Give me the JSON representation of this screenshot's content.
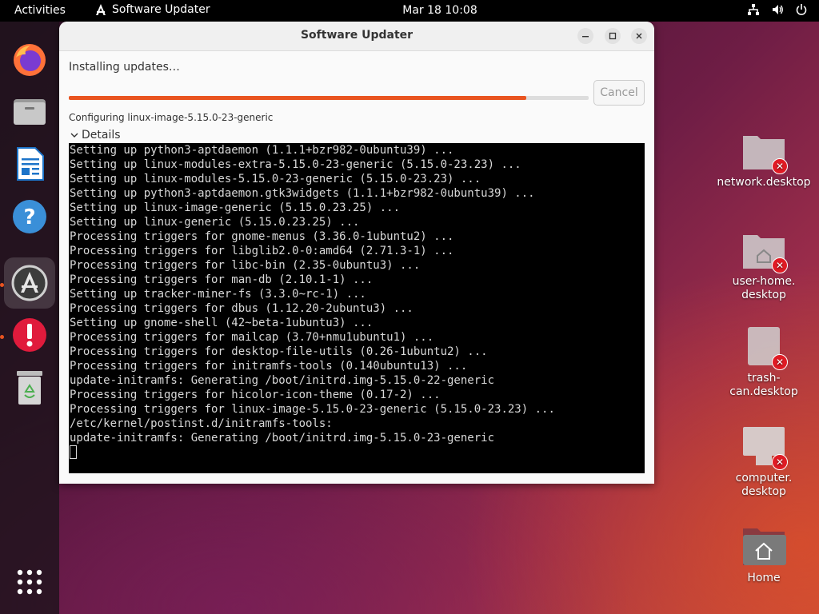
{
  "topbar": {
    "activities": "Activities",
    "app_name": "Software Updater",
    "clock": "Mar 18  10:08"
  },
  "dock": {
    "items": [
      "firefox-icon",
      "files-icon",
      "writer-icon",
      "help-icon",
      "software-updater-icon",
      "error-reporter-icon",
      "trash-icon",
      "app-grid-icon"
    ]
  },
  "window": {
    "title": "Software Updater",
    "status": "Installing updates…",
    "progress": 0.88,
    "cancel_label": "Cancel",
    "config_line": "Configuring linux-image-5.15.0-23-generic",
    "details_label": "Details",
    "terminal_lines": [
      "Setting up python3-aptdaemon (1.1.1+bzr982-0ubuntu39) ...",
      "Setting up linux-modules-extra-5.15.0-23-generic (5.15.0-23.23) ...",
      "Setting up linux-modules-5.15.0-23-generic (5.15.0-23.23) ...",
      "Setting up python3-aptdaemon.gtk3widgets (1.1.1+bzr982-0ubuntu39) ...",
      "Setting up linux-image-generic (5.15.0.23.25) ...",
      "Setting up linux-generic (5.15.0.23.25) ...",
      "Processing triggers for gnome-menus (3.36.0-1ubuntu2) ...",
      "Processing triggers for libglib2.0-0:amd64 (2.71.3-1) ...",
      "Processing triggers for libc-bin (2.35-0ubuntu3) ...",
      "Processing triggers for man-db (2.10.1-1) ...",
      "Setting up tracker-miner-fs (3.3.0~rc-1) ...",
      "Processing triggers for dbus (1.12.20-2ubuntu3) ...",
      "Setting up gnome-shell (42~beta-1ubuntu3) ...",
      "Processing triggers for mailcap (3.70+nmu1ubuntu1) ...",
      "Processing triggers for desktop-file-utils (0.26-1ubuntu2) ...",
      "Processing triggers for initramfs-tools (0.140ubuntu13) ...",
      "update-initramfs: Generating /boot/initrd.img-5.15.0-22-generic",
      "Processing triggers for hicolor-icon-theme (0.17-2) ...",
      "Processing triggers for linux-image-5.15.0-23-generic (5.15.0-23.23) ...",
      "/etc/kernel/postinst.d/initramfs-tools:",
      "update-initramfs: Generating /boot/initrd.img-5.15.0-23-generic"
    ]
  },
  "desktop": {
    "network": "network.desktop",
    "user_home_1": "user-home.",
    "user_home_2": "desktop",
    "trash": "trash-can.desktop",
    "computer_1": "computer.",
    "computer_2": "desktop",
    "home": "Home"
  }
}
